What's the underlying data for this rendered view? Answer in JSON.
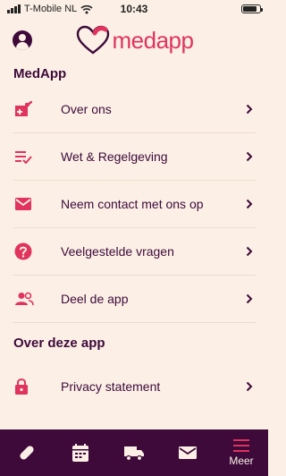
{
  "status_bar": {
    "carrier": "T-Mobile NL",
    "time": "10:43",
    "battery_level": 0.85
  },
  "header": {
    "logo_text": "medapp"
  },
  "sections": [
    {
      "title": "MedApp",
      "items": [
        {
          "label": "Over ons",
          "icon": "medical-kit-icon"
        },
        {
          "label": "Wet & Regelgeving",
          "icon": "checklist-icon"
        },
        {
          "label": "Neem contact met ons op",
          "icon": "mail-icon"
        },
        {
          "label": "Veelgestelde vragen",
          "icon": "question-icon"
        },
        {
          "label": "Deel de app",
          "icon": "people-icon"
        }
      ]
    },
    {
      "title": "Over deze app",
      "items": [
        {
          "label": "Privacy statement",
          "icon": "lock-icon"
        }
      ]
    }
  ],
  "tabbar": {
    "tabs": [
      {
        "icon": "pill-icon",
        "label": ""
      },
      {
        "icon": "calendar-icon",
        "label": ""
      },
      {
        "icon": "truck-icon",
        "label": ""
      },
      {
        "icon": "mail-icon",
        "label": ""
      },
      {
        "icon": "menu-icon",
        "label": "Meer"
      }
    ],
    "active_index": 4
  },
  "colors": {
    "background": "#fcf0e6",
    "primary": "#3d0a3a",
    "accent": "#e0345e"
  }
}
